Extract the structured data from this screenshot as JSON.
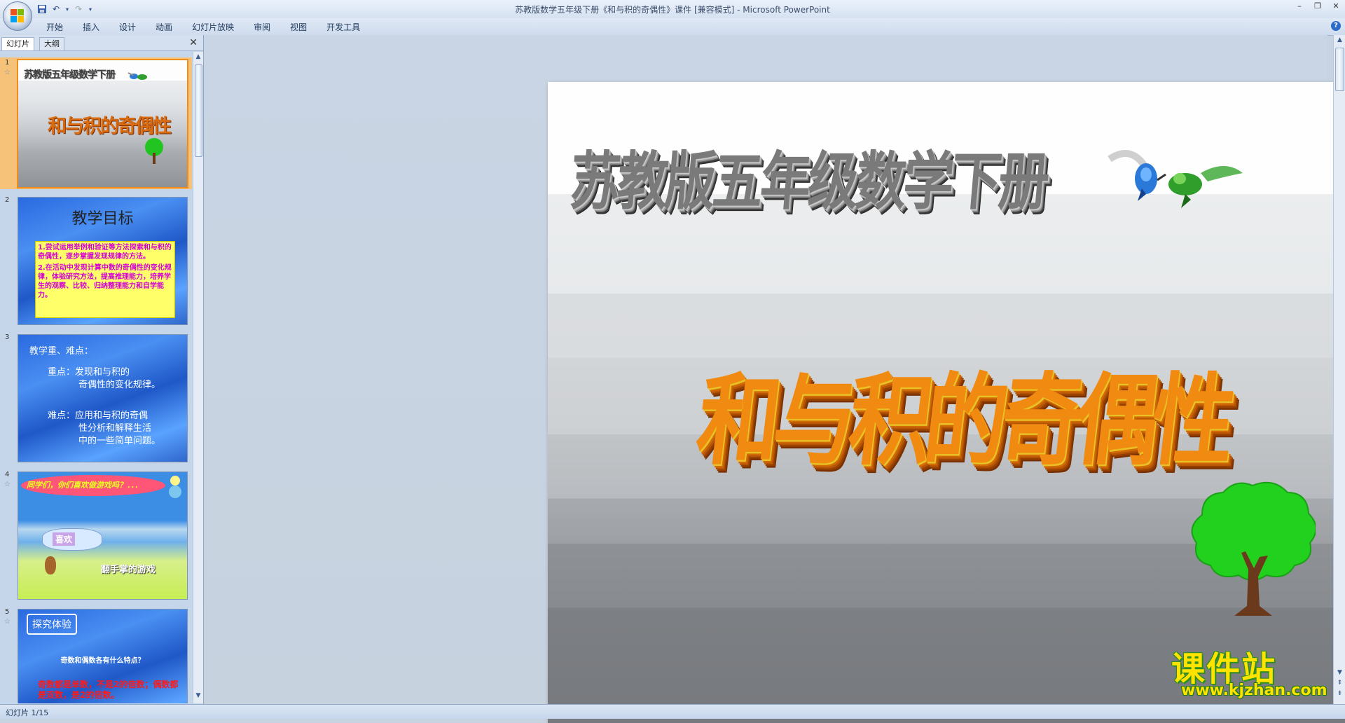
{
  "window": {
    "title": "苏教版数学五年级下册《和与积的奇偶性》课件 [兼容模式] - Microsoft PowerPoint"
  },
  "qat": {
    "icons": [
      "save-icon",
      "undo-icon",
      "redo-icon",
      "customize-icon"
    ]
  },
  "ribbon": {
    "tabs": [
      "开始",
      "插入",
      "设计",
      "动画",
      "幻灯片放映",
      "审阅",
      "视图",
      "开发工具"
    ]
  },
  "pane": {
    "tab_slides": "幻灯片",
    "tab_outline": "大纲"
  },
  "thumbs": [
    {
      "num": "1",
      "header": "苏教版五年级数学下册",
      "title": "和与积的奇偶性"
    },
    {
      "num": "2",
      "title": "教学目标",
      "p1": "1.尝试运用举例和验证等方法探索和与积的奇偶性，逐步掌握发现规律的方法。",
      "p2": "2.在活动中发现计算中数的奇偶性的变化规律，体验研究方法，提高推理能力，培养学生的观察、比较、归纳整理能力和自学能力。"
    },
    {
      "num": "3",
      "l1": "教学重、难点：",
      "l2": "重点：发现和与积的",
      "l3": "奇偶性的变化规律。",
      "l4": "难点：应用和与积的奇偶",
      "l5": "性分析和解释生活",
      "l6": "中的一些简单问题。"
    },
    {
      "num": "4",
      "bubble": "同学们，你们喜欢做游戏吗？．．．",
      "cloud": "喜欢",
      "game": "翻手掌的游戏"
    },
    {
      "num": "5",
      "box": "探究体验",
      "q": "奇数和偶数各有什么特点？",
      "r": "奇数都是单数，不是2的倍数；偶数都是双数，是2的倍数。"
    }
  ],
  "slide": {
    "header": "苏教版五年级数学下册",
    "title": "和与积的奇偶性"
  },
  "watermark": {
    "cn": "课件站",
    "url": "www.kjzhan.com"
  },
  "status": {
    "text": "幻灯片 1/15"
  },
  "colors": {
    "accent_selected": "#f08c1a",
    "title_orange": "#f18a10",
    "watermark_yellow": "#ffe300"
  }
}
